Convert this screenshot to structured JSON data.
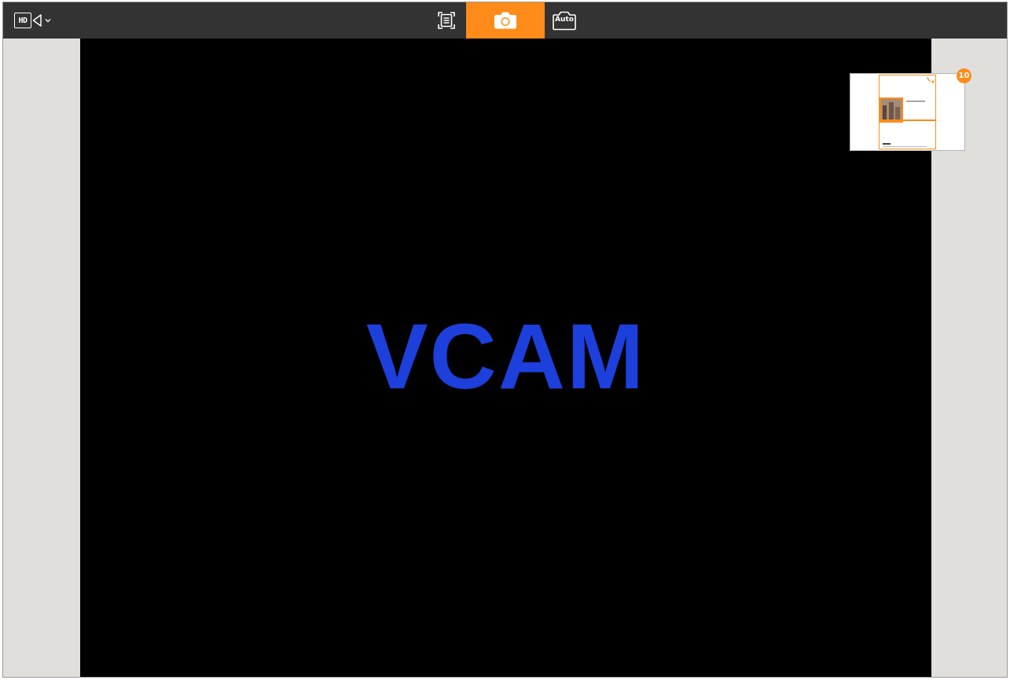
{
  "toolbar": {
    "resolution_label": "HD",
    "auto_capture_label": "Auto"
  },
  "preview": {
    "feed_text": "VCAM"
  },
  "captures": {
    "count": "10"
  },
  "colors": {
    "toolbar_bg": "#333333",
    "accent": "#ff8c1a",
    "workspace_bg": "#e0dfdb",
    "preview_bg": "#000000",
    "feed_text": "#1d3fdc"
  },
  "icons": {
    "resolution": "hd-camera-icon",
    "resolution_menu": "chevron-down-icon",
    "scan": "document-scan-icon",
    "capture": "camera-icon",
    "auto_capture": "auto-camera-icon"
  }
}
